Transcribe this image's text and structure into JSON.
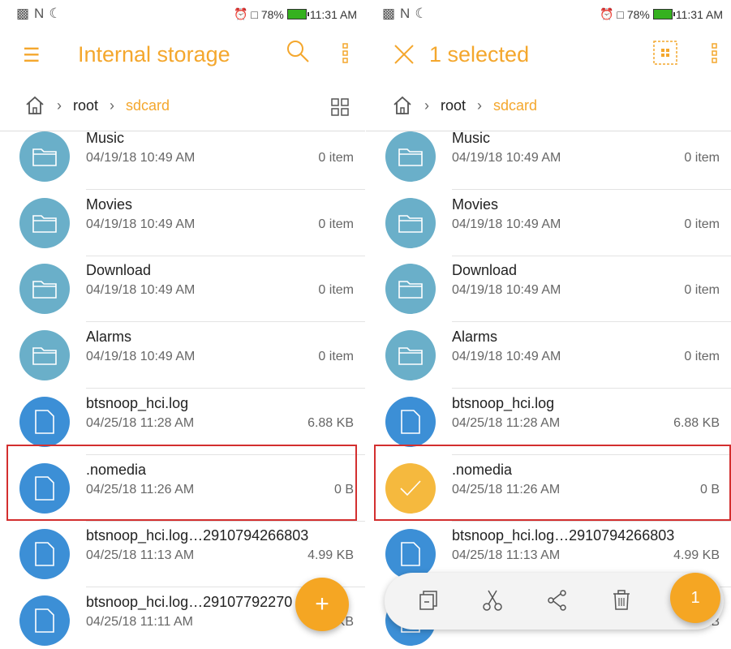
{
  "status_bar": {
    "battery": "78%",
    "time": "11:31 AM"
  },
  "left": {
    "title": "Internal storage",
    "breadcrumb": {
      "root": "root",
      "current": "sdcard"
    },
    "fab_label": "+"
  },
  "right": {
    "title": "1 selected",
    "breadcrumb": {
      "root": "root",
      "current": "sdcard"
    },
    "selected_count": "1"
  },
  "files": [
    {
      "name": "Music",
      "date": "04/19/18 10:49 AM",
      "size": "0 item",
      "kind": "folder"
    },
    {
      "name": "Movies",
      "date": "04/19/18 10:49 AM",
      "size": "0 item",
      "kind": "folder"
    },
    {
      "name": "Download",
      "date": "04/19/18 10:49 AM",
      "size": "0 item",
      "kind": "folder"
    },
    {
      "name": "Alarms",
      "date": "04/19/18 10:49 AM",
      "size": "0 item",
      "kind": "folder"
    },
    {
      "name": "btsnoop_hci.log",
      "date": "04/25/18 11:28 AM",
      "size": "6.88 KB",
      "kind": "file"
    },
    {
      "name": ".nomedia",
      "date": "04/25/18 11:26 AM",
      "size": "0 B",
      "kind": "file"
    },
    {
      "name": "btsnoop_hci.log…2910794266803",
      "date": "04/25/18 11:13 AM",
      "size": "4.99 KB",
      "kind": "file"
    },
    {
      "name": "btsnoop_hci.log…29107792270",
      "date": "04/25/18 11:11 AM",
      "size": "KB",
      "kind": "file"
    }
  ],
  "colors": {
    "accent": "#f4a72d",
    "folder": "#6aafc9",
    "file": "#3c8fd6",
    "selected": "#f5b93e",
    "highlight": "#d32f2f"
  }
}
